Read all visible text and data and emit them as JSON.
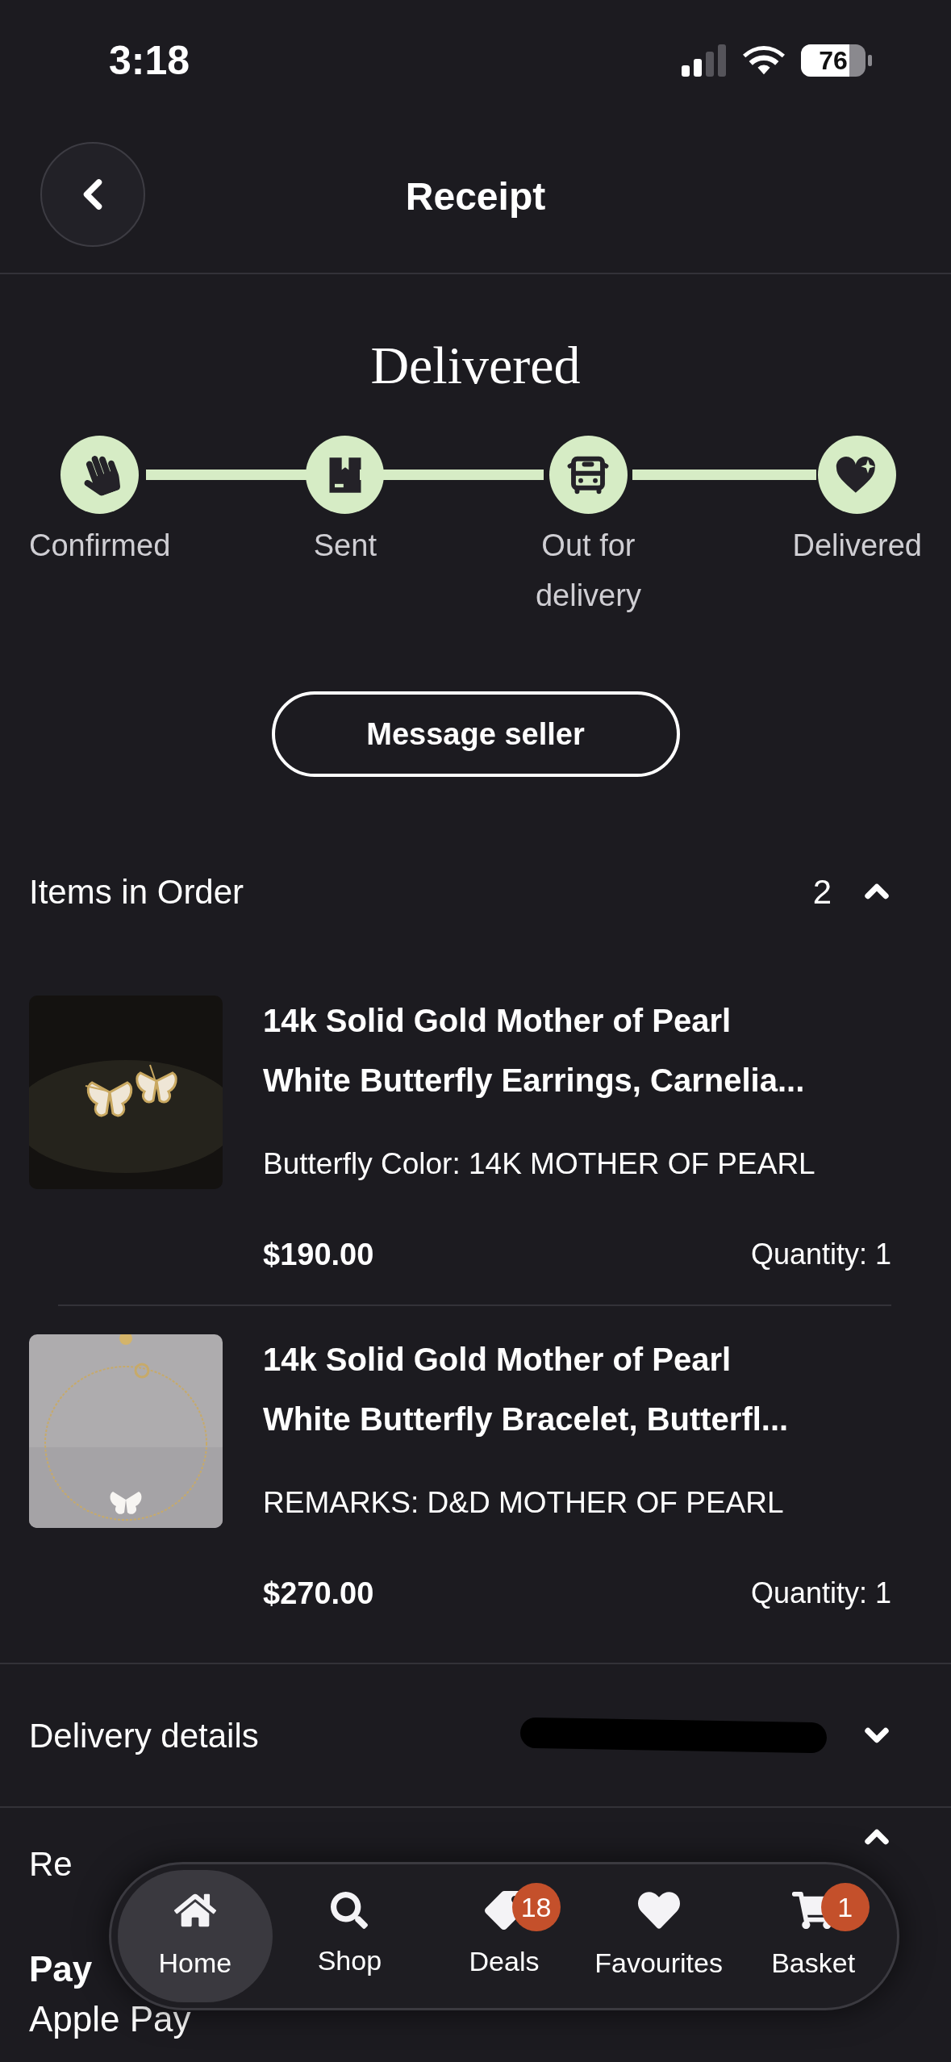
{
  "status_bar": {
    "time": "3:18",
    "battery": "76"
  },
  "header": {
    "title": "Receipt"
  },
  "order_status": {
    "title": "Delivered",
    "steps": [
      {
        "label": "Confirmed",
        "completed": true,
        "kind": "hand"
      },
      {
        "label": "Sent",
        "completed": true,
        "kind": "box"
      },
      {
        "label": "Out for delivery",
        "completed": true,
        "kind": "vehicle"
      },
      {
        "label": "Delivered",
        "completed": true,
        "kind": "heart"
      }
    ]
  },
  "message_button": "Message seller",
  "items_section": {
    "title": "Items in Order",
    "count": "2",
    "expanded": true,
    "items": [
      {
        "kind": "earrings",
        "title_lines": [
          "14k Solid Gold Mother of Pearl",
          "White Butterfly Earrings, Carnelia..."
        ],
        "variation": "Butterfly Color: 14K MOTHER OF PEARL",
        "price": "$190.00",
        "quantity": "Quantity: 1"
      },
      {
        "kind": "bracelet",
        "title_lines": [
          "14k Solid Gold Mother of Pearl",
          "White Butterfly Bracelet, Butterfl..."
        ],
        "variation": "REMARKS: D&D MOTHER OF PEARL",
        "price": "$270.00",
        "quantity": "Quantity: 1"
      }
    ]
  },
  "delivery_details": {
    "label": "Delivery details",
    "expanded": false
  },
  "receipt_section": {
    "label": "Re",
    "expanded": true
  },
  "payment": {
    "label": "Pay",
    "value": "Apple Pay"
  },
  "nav": [
    {
      "kind": "home",
      "label": "Home",
      "selected": true
    },
    {
      "kind": "search",
      "label": "Shop",
      "selected": false
    },
    {
      "kind": "tag",
      "label": "Deals",
      "selected": false,
      "badge": "18"
    },
    {
      "kind": "heart",
      "label": "Favourites",
      "selected": false
    },
    {
      "kind": "cart",
      "label": "Basket",
      "selected": false,
      "badge": "1"
    }
  ]
}
